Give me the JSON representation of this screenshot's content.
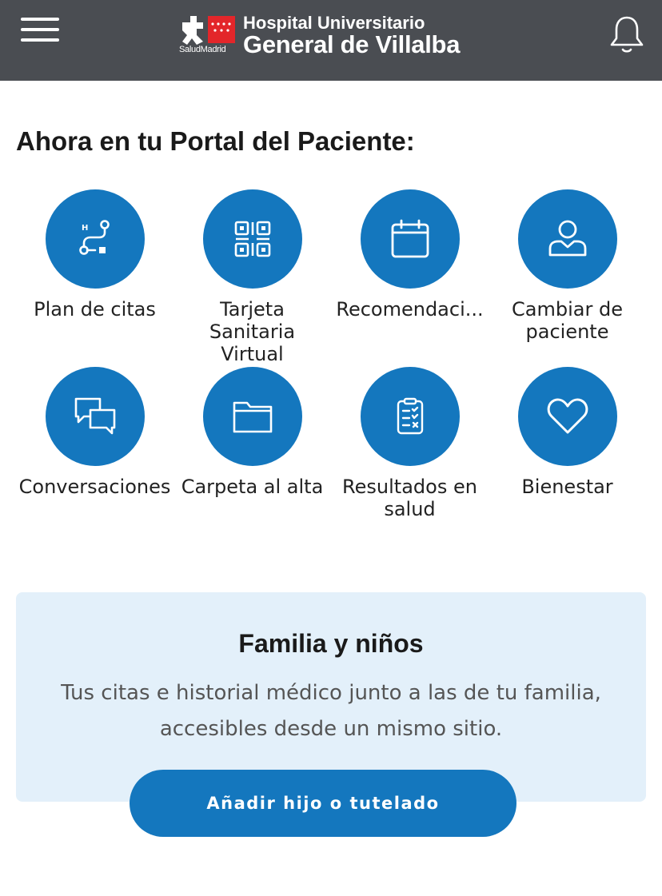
{
  "header": {
    "logo_brand": "SaludMadrid",
    "logo_line1": "Hospital Universitario",
    "logo_line2": "General de Villalba",
    "icons": {
      "menu": "hamburger-icon",
      "notifications": "bell-icon"
    }
  },
  "main": {
    "title": "Ahora en tu Portal del Paciente:",
    "tiles": [
      {
        "label": "Plan de citas",
        "icon": "route-icon"
      },
      {
        "label": "Tarjeta Sanitaria Virtual",
        "icon": "qr-code-icon"
      },
      {
        "label": "Recomendaci...",
        "icon": "calendar-icon"
      },
      {
        "label": "Cambiar de paciente",
        "icon": "user-icon"
      },
      {
        "label": "Conversaciones",
        "icon": "chat-bubbles-icon"
      },
      {
        "label": "Carpeta al alta",
        "icon": "folder-icon"
      },
      {
        "label": "Resultados en salud",
        "icon": "clipboard-checklist-icon"
      },
      {
        "label": "Bienestar",
        "icon": "heart-icon"
      }
    ]
  },
  "family": {
    "title": "Familia y niños",
    "description": "Tus citas e historial médico junto a las de tu familia, accesibles desde un mismo sitio.",
    "button_label": "Añadir hijo o tutelado"
  },
  "colors": {
    "header_bg": "#4a4d52",
    "accent": "#1477be",
    "card_bg": "#e3f0fa",
    "logo_red": "#e3262a"
  }
}
